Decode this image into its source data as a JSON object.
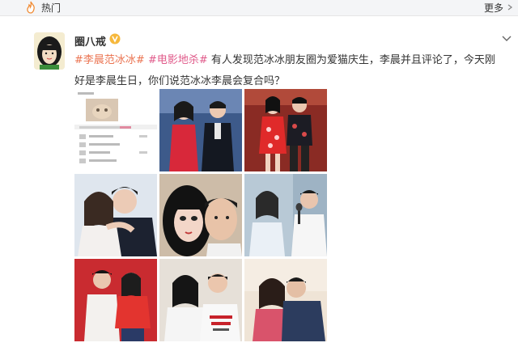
{
  "header": {
    "title": "热门",
    "more_label": "更多"
  },
  "post": {
    "username": "圈八戒",
    "verified": true,
    "tags": [
      "#李晨范冰冰#",
      "#电影地杀#"
    ],
    "text": "有人发现范冰冰朋友圈为爱猫庆生，李晨并且评论了，今天刚好是李晨生日，你们说范冰冰李晨会复合吗？"
  },
  "images": [
    {
      "name": "screenshot-chat"
    },
    {
      "name": "couple-event-red-dress"
    },
    {
      "name": "couple-red-floral-dress"
    },
    {
      "name": "couple-embrace-white"
    },
    {
      "name": "couple-selfie"
    },
    {
      "name": "couple-microphone"
    },
    {
      "name": "couple-red-backdrop"
    },
    {
      "name": "couple-made-in-china-tees"
    },
    {
      "name": "couple-kiss"
    }
  ],
  "colors": {
    "tag": "#eb7350",
    "tag_pink": "#e05a8a",
    "badge": "#f6b83c",
    "fire": "#f08c36"
  }
}
